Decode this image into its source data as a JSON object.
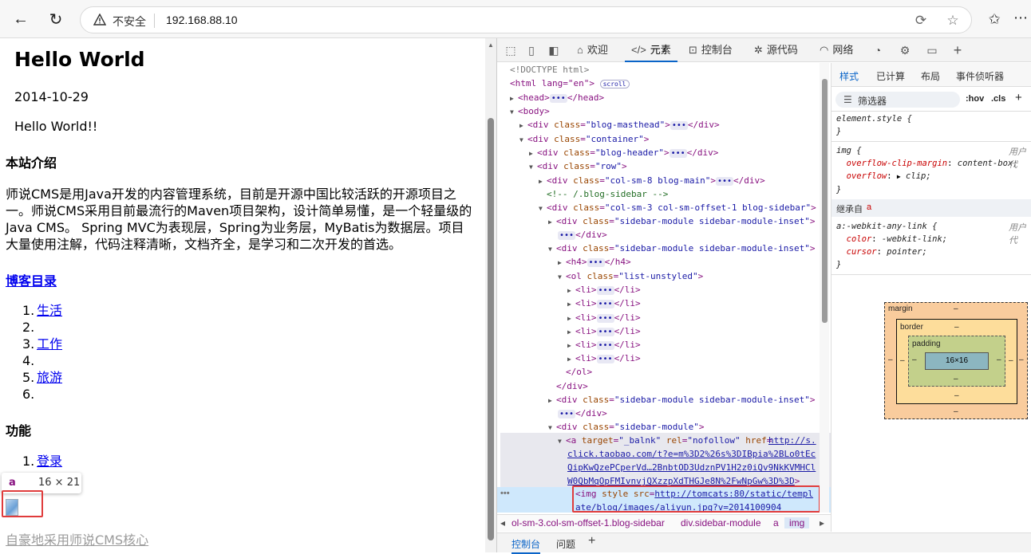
{
  "browser": {
    "security_label": "不安全",
    "url": "192.168.88.10"
  },
  "page": {
    "title": "Hello World",
    "date": "2014-10-29",
    "hello": "Hello World!!",
    "intro_heading": "本站介绍",
    "intro_text": "师说CMS是用Java开发的内容管理系统，目前是开源中国比较活跃的开源项目之一。师说CMS采用目前最流行的Maven项目架构，设计简单易懂，是一个轻量级的Java CMS。 Spring MVC为表现层，Spring为业务层，MyBatis为数据层。项目大量使用注解，代码注释清晰，文档齐全，是学习和二次开发的首选。",
    "blog_heading": "博客目录",
    "blog_items": [
      {
        "num": "1.",
        "label": "生活"
      },
      {
        "num": "2.",
        "label": ""
      },
      {
        "num": "3.",
        "label": "工作"
      },
      {
        "num": "4.",
        "label": ""
      },
      {
        "num": "5.",
        "label": "旅游"
      },
      {
        "num": "6.",
        "label": ""
      }
    ],
    "func_heading": "功能",
    "func_items": [
      {
        "num": "1.",
        "label": "登录"
      }
    ],
    "tooltip_tag": "a",
    "tooltip_dim": "16 × 21",
    "footer_link": "自豪地采用师说CMS核心"
  },
  "devtools": {
    "tabs": [
      {
        "label": "欢迎",
        "icon": "home-icon"
      },
      {
        "label": "元素",
        "icon": "code-icon"
      },
      {
        "label": "控制台",
        "icon": "console-icon"
      },
      {
        "label": "源代码",
        "icon": "bug-icon"
      },
      {
        "label": "网络",
        "icon": "wifi-icon"
      }
    ],
    "elements": {
      "doctype": "<!DOCTYPE html>",
      "html_open": "<html lang=\"en\">",
      "scroll_badge": "scroll",
      "comment": "<!-- /.blog-sidebar -->",
      "href_val": "http://s.click.taobao.com/t?e=m%3D2%26s%3DIBpia%2BLo0tEcQipKwQzePCperVd…2BnbtOD3UdznPV1H2z0iQv9NkKVMHClW0QbMqOpFMIvnvjQXzzpXdTHGJe8N%2FwNpGw%3D%3D",
      "img_src": "http://tomcats:80/static/template/blog/images/aliyun.jpg?v=2014100904"
    },
    "breadcrumb": [
      "ol-sm-3.col-sm-offset-1.blog-sidebar",
      "div.sidebar-module",
      "a",
      "img"
    ],
    "drawer": [
      "控制台",
      "问题"
    ],
    "styles": {
      "tabs": [
        "样式",
        "已计算",
        "布局",
        "事件侦听器"
      ],
      "filter_label": "筛选器",
      "hov": ":hov",
      "cls": ".cls",
      "element_style": "element.style {",
      "img_rule_sel": "img {",
      "ua_label": "用户代",
      "prop1": "overflow-clip-margin",
      "val1": "content-box;",
      "prop2": "overflow",
      "val2": "clip;",
      "inherit_label": "继承自",
      "inherit_tag": "a",
      "link_sel": "a:-webkit-any-link {",
      "prop3": "color",
      "val3": "-webkit-link;",
      "prop4": "cursor",
      "val4": "pointer;",
      "box_margin": "margin",
      "box_border": "border",
      "box_padding": "padding",
      "box_content": "16×16",
      "box_dash": "–"
    }
  }
}
